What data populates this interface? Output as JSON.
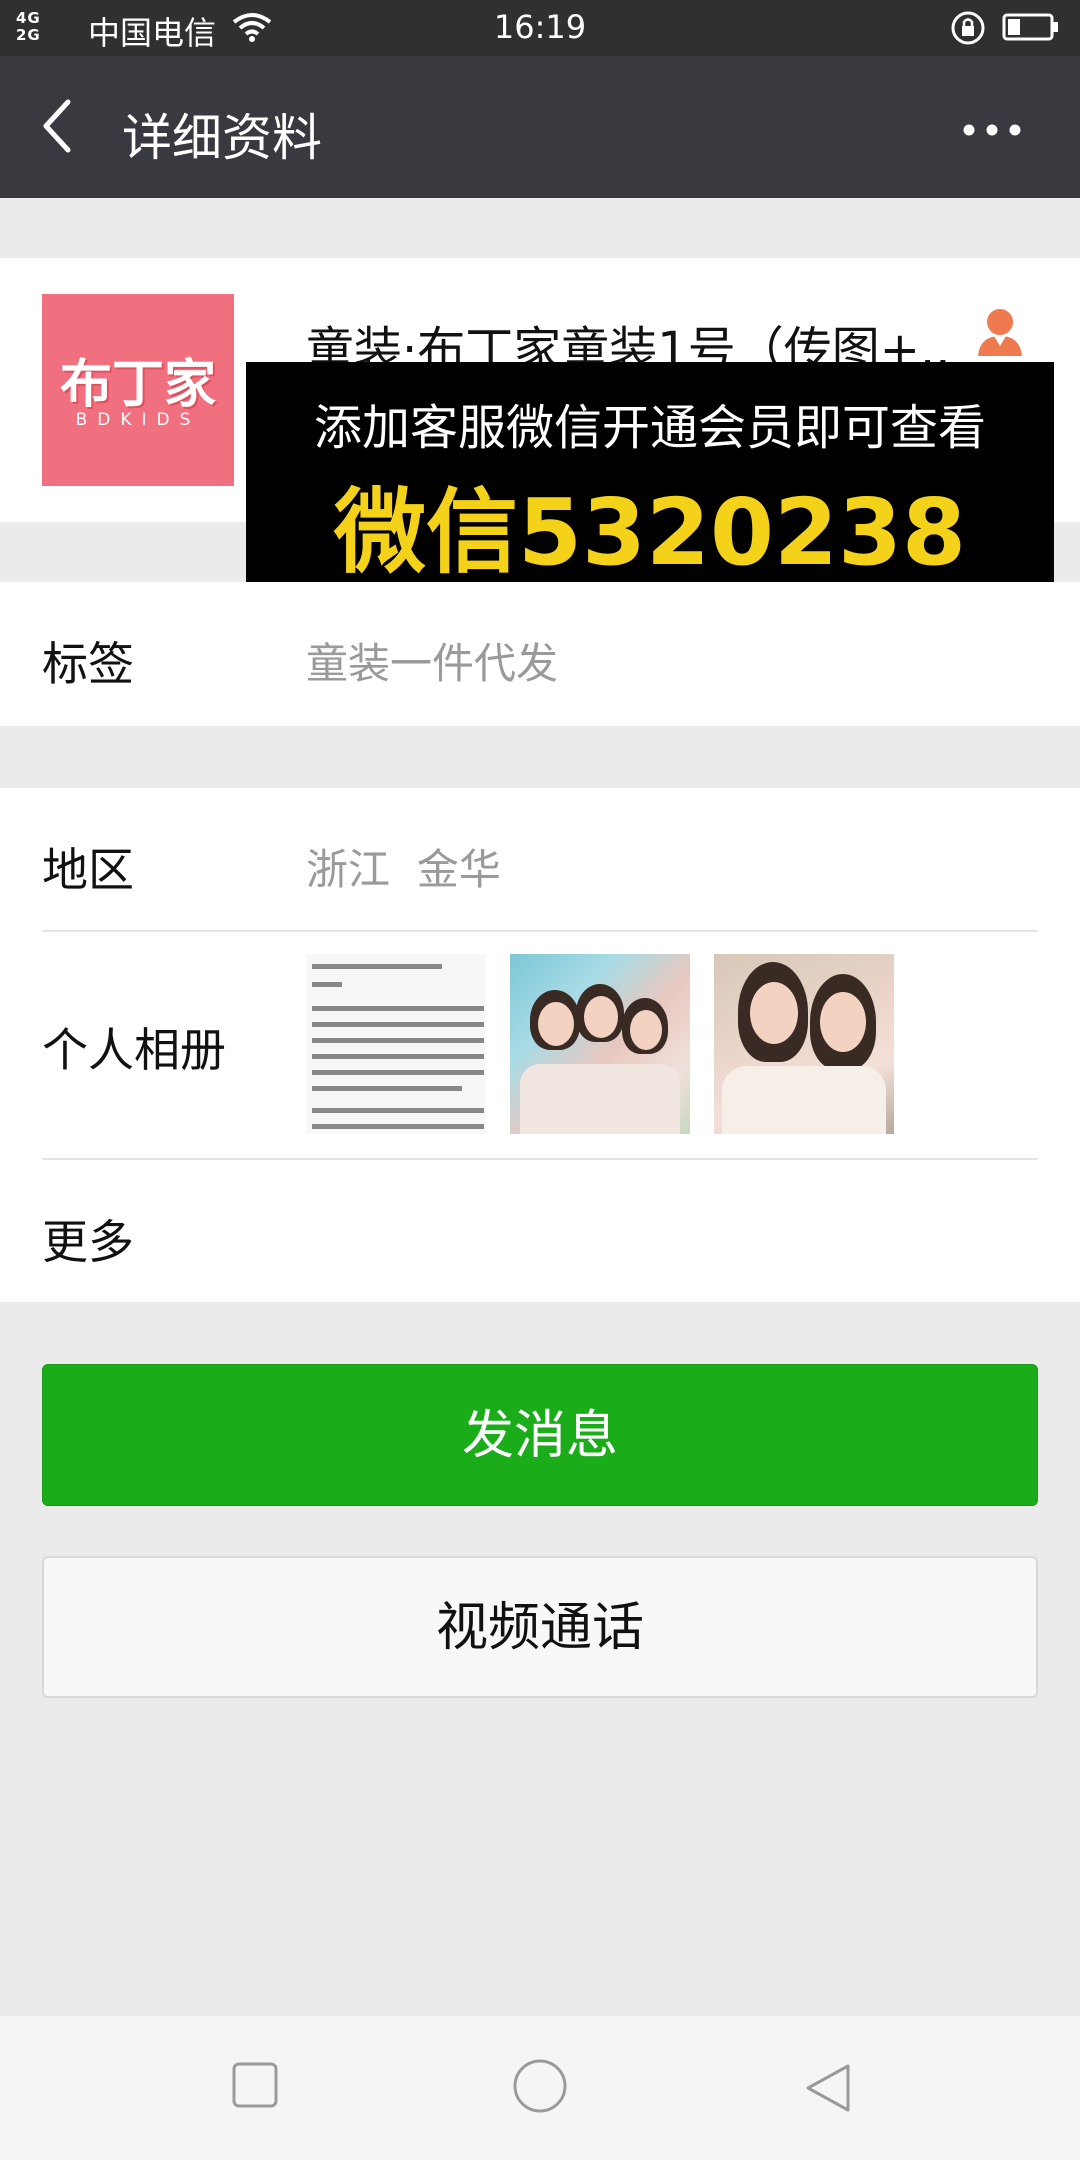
{
  "status_bar": {
    "network_top": "4G",
    "network_bottom": "2G",
    "carrier": "中国电信",
    "time": "16:19"
  },
  "header": {
    "title": "详细资料"
  },
  "profile": {
    "avatar_text": "布丁家",
    "avatar_subtext": "BDKIDS",
    "name": "童装·布丁家童装1号（传图+..."
  },
  "ad_overlay": {
    "line1": "添加客服微信开通会员即可查看",
    "line2": "微信5320238"
  },
  "tags": {
    "label": "标签",
    "value": "童装一件代发"
  },
  "region": {
    "label": "地区",
    "value": "浙江  金华"
  },
  "album": {
    "label": "个人相册"
  },
  "more": {
    "label": "更多"
  },
  "actions": {
    "send_message": "发消息",
    "video_call": "视频通话"
  },
  "colors": {
    "primary_green": "#1aad19",
    "title_bar": "#393a3f",
    "ad_yellow": "#f5d21a"
  }
}
